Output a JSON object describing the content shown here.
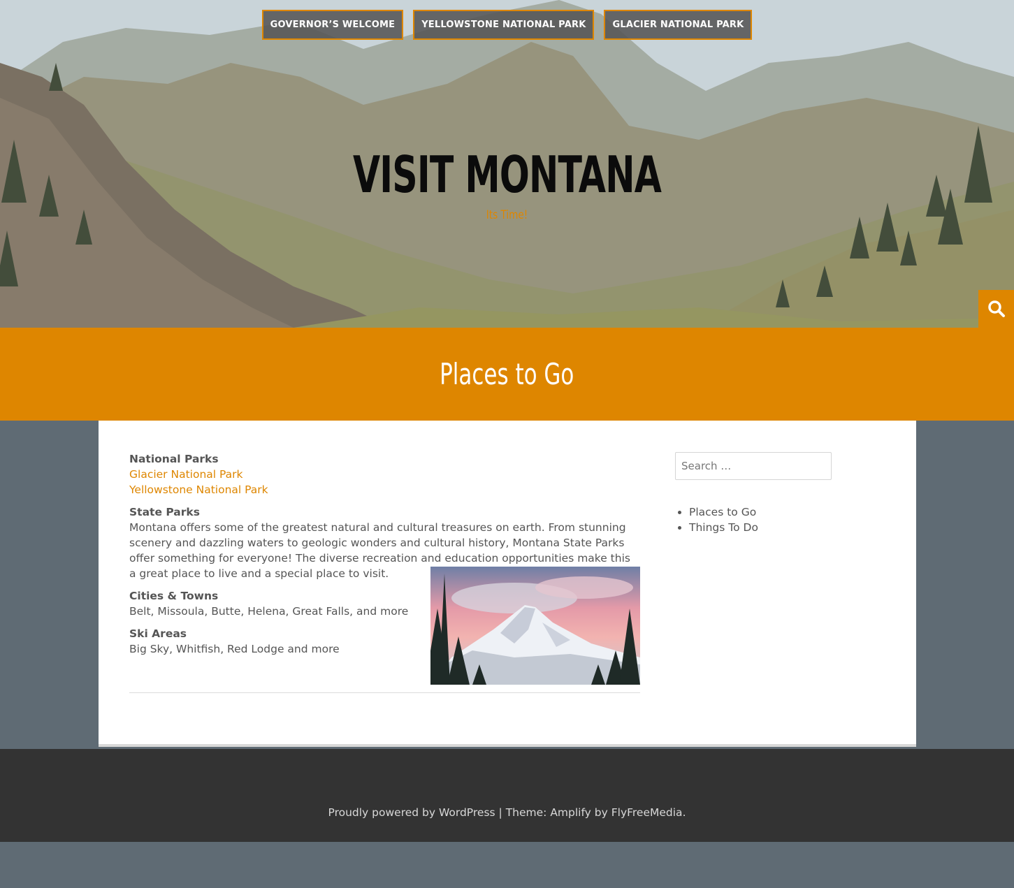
{
  "nav": {
    "items": [
      {
        "label": "GOVERNOR’S WELCOME"
      },
      {
        "label": "YELLOWSTONE NATIONAL PARK"
      },
      {
        "label": "GLACIER NATIONAL PARK"
      }
    ]
  },
  "site": {
    "title": "VISIT MONTANA",
    "tagline": "Its Time!"
  },
  "page": {
    "title": "Places to Go"
  },
  "content": {
    "national_parks": {
      "heading": "National Parks",
      "links": [
        "Glacier National Park",
        "Yellowstone National Park"
      ]
    },
    "state_parks": {
      "heading": "State Parks",
      "text": "Montana offers some of the greatest natural and cultural treasures on earth. From stunning scenery and dazzling waters to geologic wonders and cultural history, Montana State Parks offer something for everyone! The diverse recreation and education opportunities make this a great place to live and a special place to visit."
    },
    "cities": {
      "heading": "Cities & Towns",
      "text": "Belt, Missoula, Butte, Helena, Great Falls, and more"
    },
    "ski": {
      "heading": "Ski Areas",
      "text": "Big Sky, Whitfish, Red Lodge and more"
    }
  },
  "sidebar": {
    "search_placeholder": "Search …",
    "menu": [
      "Places to Go",
      "Things To Do"
    ]
  },
  "footer": {
    "powered": "Proudly powered by WordPress",
    "separator": "|",
    "theme_prefix": "Theme: Amplify by ",
    "theme_author": "FlyFreeMedia",
    "period": "."
  },
  "colors": {
    "accent": "#de8600",
    "background": "#5f6b74",
    "footer": "#333333",
    "nav_button": "#555555"
  },
  "icons": {
    "search_toggle": "search-icon"
  }
}
